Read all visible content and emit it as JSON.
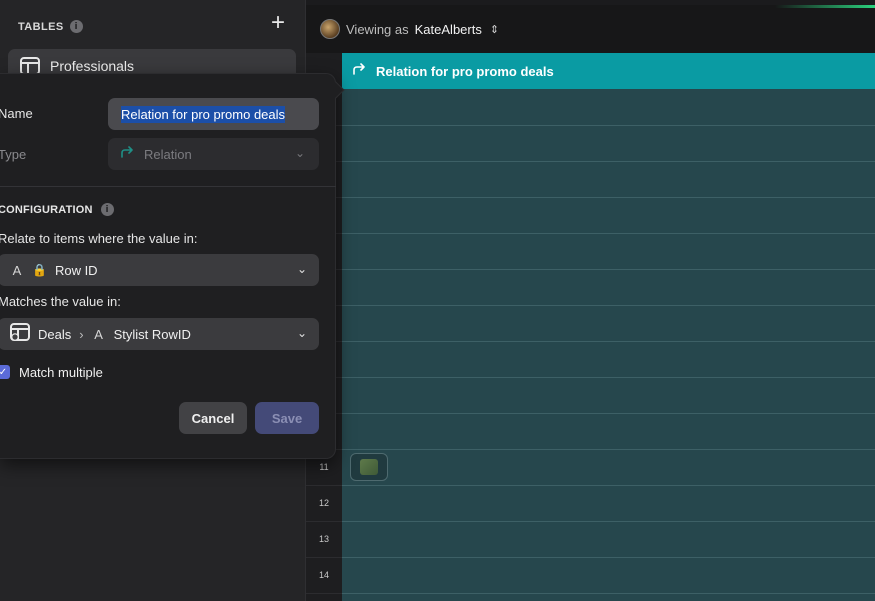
{
  "sidebar": {
    "title": "TABLES",
    "add_icon": "plus-icon",
    "items": [
      {
        "label": "Professionals",
        "icon": "table-icon"
      }
    ]
  },
  "topbar": {
    "viewing_label": "Viewing as",
    "user": "KateAlberts",
    "switch_icon": "chevron-up-down-icon"
  },
  "grid": {
    "column_header": "Relation for pro promo deals",
    "column_icon": "relation-arrow-icon",
    "row_numbers": [
      "11",
      "12",
      "13",
      "14"
    ]
  },
  "popover": {
    "name_label": "Name",
    "name_value": "Relation for pro promo deals",
    "type_label": "Type",
    "type_value": "Relation",
    "section_title": "CONFIGURATION",
    "relate_label": "Relate to items where the value in:",
    "relate_glyph": "A",
    "relate_value": "Row ID",
    "matches_label": "Matches the value in:",
    "matches_table": "Deals",
    "matches_glyph": "A",
    "matches_column": "Stylist RowID",
    "match_multiple_label": "Match multiple",
    "match_multiple_checked": true,
    "cancel_label": "Cancel",
    "save_label": "Save"
  },
  "colors": {
    "accent": "#0a9ba3",
    "checkbox": "#5b6bd8",
    "save_disabled": "#444a78"
  }
}
